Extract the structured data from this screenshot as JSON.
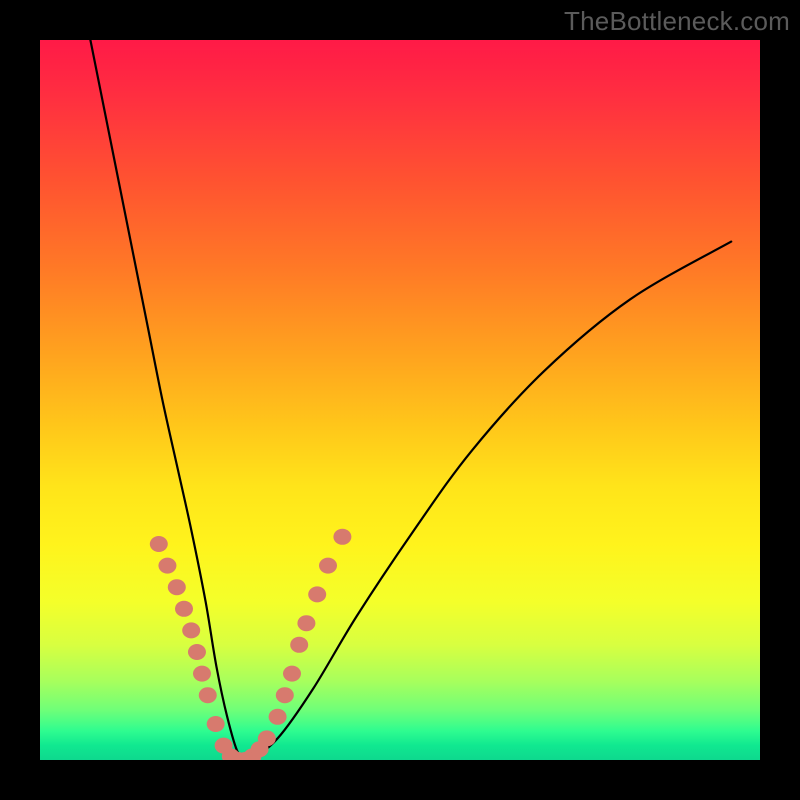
{
  "watermark": "TheBottleneck.com",
  "chart_data": {
    "type": "line",
    "title": "",
    "xlabel": "",
    "ylabel": "",
    "xlim": [
      0,
      100
    ],
    "ylim": [
      0,
      100
    ],
    "series": [
      {
        "name": "bottleneck-curve",
        "x": [
          7,
          9,
          11,
          13,
          15,
          17,
          19,
          21,
          23,
          24.5,
          26,
          27.5,
          29,
          33,
          38,
          44,
          52,
          60,
          70,
          82,
          96
        ],
        "y": [
          100,
          90,
          80,
          70,
          60,
          50,
          41,
          32,
          22,
          13,
          6,
          1,
          0,
          3,
          10,
          20,
          32,
          43,
          54,
          64,
          72
        ]
      }
    ],
    "markers": {
      "name": "highlight-points",
      "color": "#d77a6e",
      "points": [
        {
          "x": 16.5,
          "y": 30
        },
        {
          "x": 17.7,
          "y": 27
        },
        {
          "x": 19.0,
          "y": 24
        },
        {
          "x": 20.0,
          "y": 21
        },
        {
          "x": 21.0,
          "y": 18
        },
        {
          "x": 21.8,
          "y": 15
        },
        {
          "x": 22.5,
          "y": 12
        },
        {
          "x": 23.3,
          "y": 9
        },
        {
          "x": 24.4,
          "y": 5
        },
        {
          "x": 25.5,
          "y": 2
        },
        {
          "x": 26.5,
          "y": 0.5
        },
        {
          "x": 27.5,
          "y": 0
        },
        {
          "x": 28.5,
          "y": 0
        },
        {
          "x": 29.5,
          "y": 0.5
        },
        {
          "x": 30.5,
          "y": 1.5
        },
        {
          "x": 31.5,
          "y": 3
        },
        {
          "x": 33.0,
          "y": 6
        },
        {
          "x": 34.0,
          "y": 9
        },
        {
          "x": 35.0,
          "y": 12
        },
        {
          "x": 36.0,
          "y": 16
        },
        {
          "x": 37.0,
          "y": 19
        },
        {
          "x": 38.5,
          "y": 23
        },
        {
          "x": 40.0,
          "y": 27
        },
        {
          "x": 42.0,
          "y": 31
        }
      ]
    }
  }
}
